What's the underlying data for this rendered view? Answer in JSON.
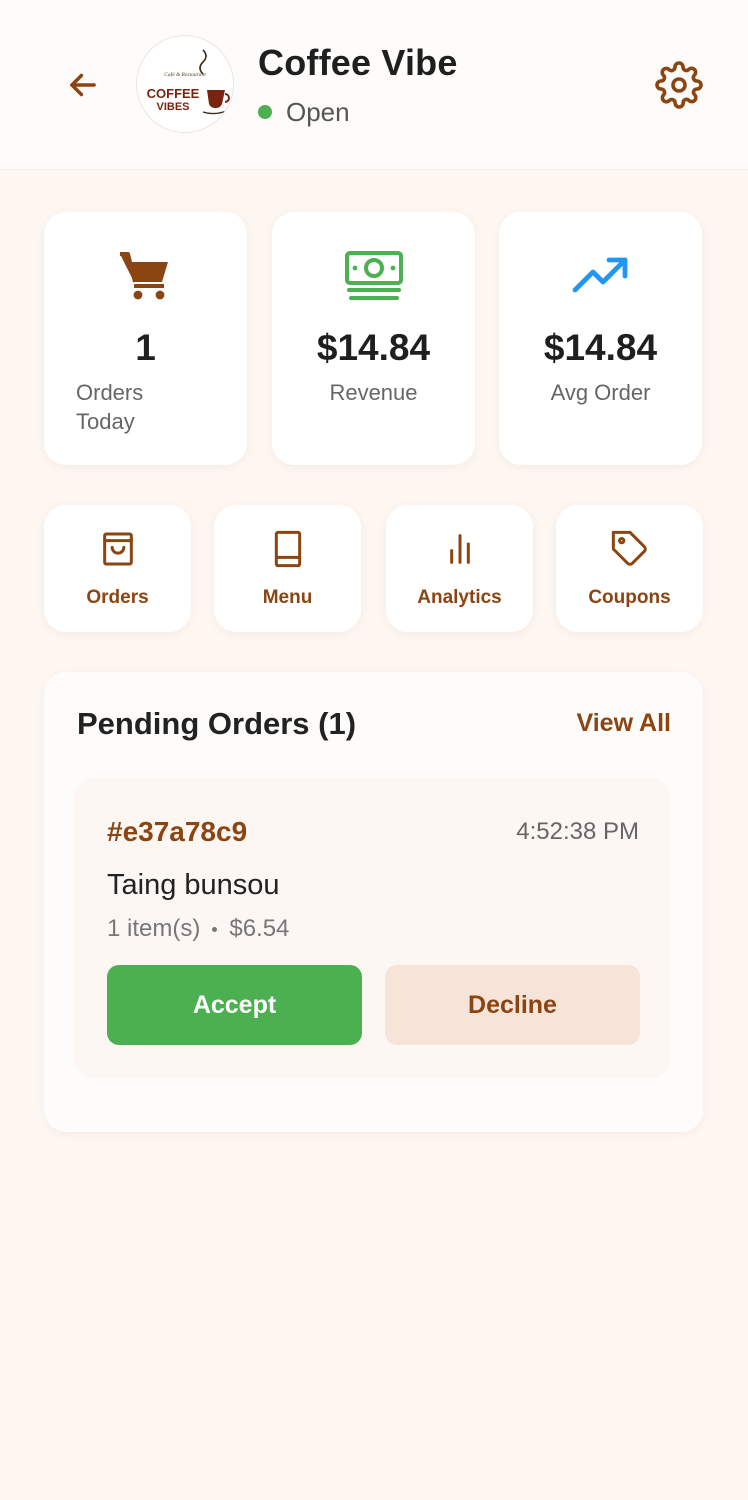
{
  "header": {
    "shop_name": "Coffee Vibe",
    "status": "Open",
    "status_color": "#4caf50",
    "logo": {
      "tagline": "Café & Restaurant",
      "line1": "COFFEE",
      "line2": "VIBES"
    },
    "icons": {
      "back": "arrow-left-icon",
      "settings": "gear-icon"
    }
  },
  "stats": [
    {
      "icon": "shopping-cart-icon",
      "value": "1",
      "label": "Orders Today",
      "icon_color": "#8b4513"
    },
    {
      "icon": "money-bill-icon",
      "value": "$14.84",
      "label": "Revenue",
      "icon_color": "#4caf50"
    },
    {
      "icon": "trending-up-icon",
      "value": "$14.84",
      "label": "Avg Order",
      "icon_color": "#2196f3"
    }
  ],
  "actions": [
    {
      "icon": "shopping-bag-icon",
      "label": "Orders"
    },
    {
      "icon": "book-icon",
      "label": "Menu"
    },
    {
      "icon": "bar-chart-icon",
      "label": "Analytics"
    },
    {
      "icon": "tag-icon",
      "label": "Coupons"
    }
  ],
  "pending": {
    "title": "Pending Orders (1)",
    "view_all": "View All",
    "orders": [
      {
        "id": "#e37a78c9",
        "time": "4:52:38 PM",
        "customer": "Taing bunsou",
        "items": "1 item(s)",
        "total": "$6.54",
        "accept_label": "Accept",
        "decline_label": "Decline"
      }
    ]
  },
  "colors": {
    "brand": "#8b4513",
    "accept": "#4caf50",
    "decline_bg": "#f6e4d8",
    "background": "#fdf6f1"
  }
}
